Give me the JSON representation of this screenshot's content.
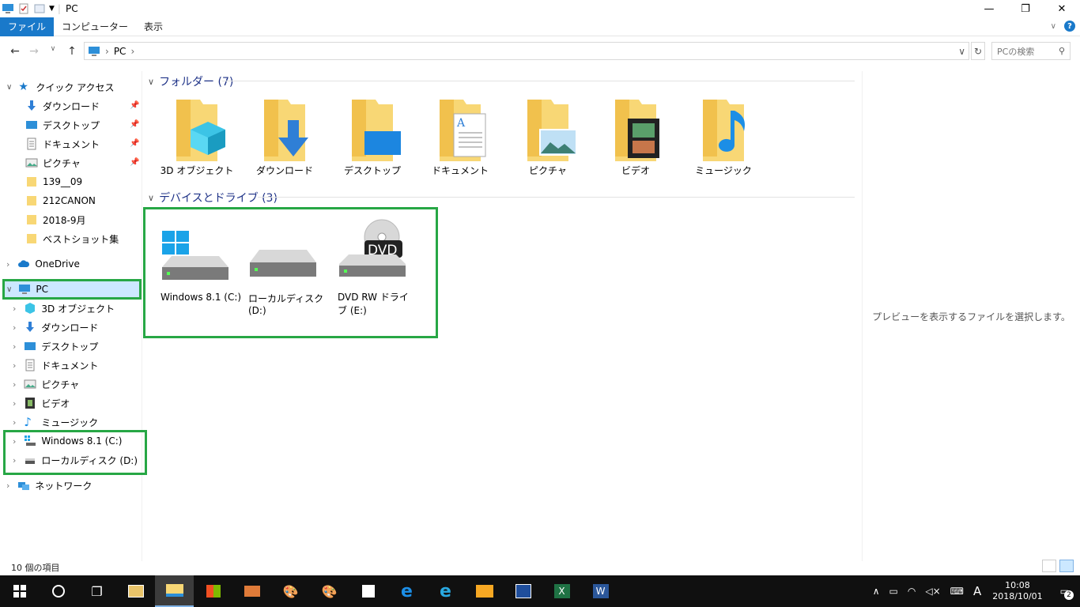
{
  "window": {
    "title": "PC"
  },
  "ribbon": {
    "tabs": [
      "ファイル",
      "コンピューター",
      "表示"
    ]
  },
  "address": {
    "path": "PC",
    "search_placeholder": "PCの検索"
  },
  "sidebar": {
    "quick_access": "クイック アクセス",
    "quick_items": [
      "ダウンロード",
      "デスクトップ",
      "ドキュメント",
      "ピクチャ",
      "139__09",
      "212CANON",
      "2018-9月",
      "ベストショット集"
    ],
    "onedrive": "OneDrive",
    "pc": "PC",
    "pc_items": [
      "3D オブジェクト",
      "ダウンロード",
      "デスクトップ",
      "ドキュメント",
      "ピクチャ",
      "ビデオ",
      "ミュージック"
    ],
    "drives": [
      "Windows 8.1 (C:)",
      "ローカルディスク (D:)"
    ],
    "network": "ネットワーク"
  },
  "main": {
    "folders_header": "フォルダー (7)",
    "folders": [
      "3D オブジェクト",
      "ダウンロード",
      "デスクトップ",
      "ドキュメント",
      "ピクチャ",
      "ビデオ",
      "ミュージック"
    ],
    "devices_header": "デバイスとドライブ (3)",
    "drives": [
      {
        "label": "Windows 8.1 (C:)"
      },
      {
        "label": "ローカルディスク (D:)"
      },
      {
        "label": "DVD RW ドライブ (E:)",
        "badge": "DVD"
      }
    ]
  },
  "preview": {
    "text": "プレビューを表示するファイルを選択します。"
  },
  "status": {
    "count": "10 個の項目"
  },
  "taskbar": {
    "ime": "A",
    "time": "10:08",
    "date": "2018/10/01",
    "notifications": "2"
  },
  "colors": {
    "accent": "#1979ca",
    "highlight": "#27a745",
    "selection": "#cce8ff",
    "folder": "#f8d775"
  }
}
